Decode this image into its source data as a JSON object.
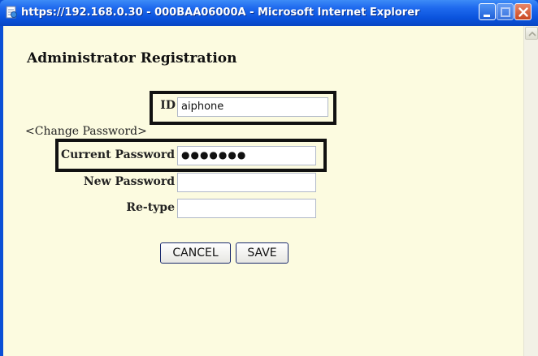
{
  "window": {
    "title": "https://192.168.0.30 - 000BAA06000A - Microsoft Internet Explorer"
  },
  "titlebar_icons": {
    "app": "internet-explorer-page-icon",
    "minimize": "minimize-icon",
    "maximize": "maximize-icon",
    "close": "close-icon"
  },
  "page": {
    "heading": "Administrator Registration",
    "id_label": "ID",
    "id_value": "aiphone",
    "change_password_label": "<Change Password>",
    "current_password_label": "Current Password",
    "current_password_value": "●●●●●●●",
    "new_password_label": "New Password",
    "new_password_value": "",
    "retype_label": "Re-type",
    "retype_value": ""
  },
  "buttons": {
    "cancel": "CANCEL",
    "save": "SAVE"
  },
  "colors": {
    "titlebar": "#0a53dd",
    "page_background": "#fcfbe0",
    "close_button": "#c9461f"
  }
}
